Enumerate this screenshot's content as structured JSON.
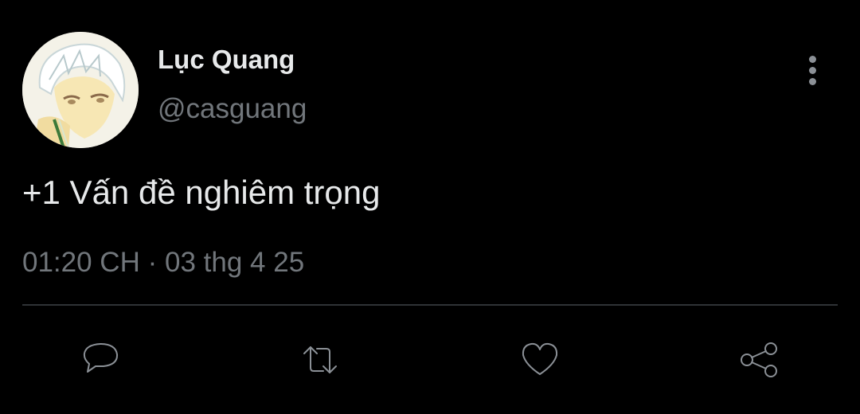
{
  "tweet": {
    "author": {
      "display_name": "Lục Quang",
      "handle": "@casguang",
      "avatar_icon": "anime-avatar"
    },
    "text": "+1 Vấn đề nghiêm trọng",
    "time": "01:20 CH",
    "separator": "·",
    "date": "03 thg 4 25"
  },
  "actions": [
    {
      "name": "reply",
      "icon": "speech-bubble-icon"
    },
    {
      "name": "retweet",
      "icon": "retweet-arrows-icon"
    },
    {
      "name": "like",
      "icon": "heart-icon"
    },
    {
      "name": "share",
      "icon": "share-nodes-icon"
    }
  ],
  "colors": {
    "background": "#000000",
    "primary_text": "#e7e9ea",
    "secondary_text": "#71767b",
    "icon": "#8b9096",
    "divider": "#2f3336"
  }
}
